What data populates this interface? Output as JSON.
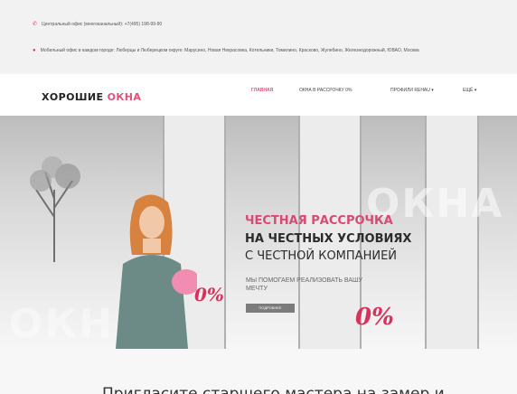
{
  "topbar": {
    "phone_text": "Центральный офис (многоканальный): +7(495) 198-99-90",
    "address_text": "Мобильный офис в каждом городе: Люберцы и Люберецком округе: Марусино, Новая Некрасовка, Котельники, Томилино, Красково, Жулебино, Железнодорожный, ЮВАО, Москва"
  },
  "header": {
    "logo_main": "ХОРОШИЕ ",
    "logo_accent": "ОКНА",
    "nav": {
      "home": "ГЛАВНАЯ",
      "installment": "ОКНА В РАССРОЧКУ 0%",
      "profiles": "ПРОФИЛИ REHAU ▾",
      "more": "ЕЩЁ ▾"
    }
  },
  "hero": {
    "headline_1": "ЧЕСТНАЯ РАССРОЧКА",
    "headline_2": "НА ЧЕСТНЫХ УСЛОВИЯХ",
    "headline_3": "С ЧЕСТНОЙ КОМПАНИЕЙ",
    "subtext": "МЫ ПОМОГАЕМ РЕАЛИЗОВАТЬ ВАШУ МЕЧТУ",
    "button_label": "ПОДРОБНЕЕ",
    "watermark_top": "ОКНА",
    "watermark_bottom": "ОКНА",
    "discount_big": "0%",
    "discount_small": "0%"
  },
  "main": {
    "cta_title": "Пригласите старшего мастера на замер и"
  },
  "colors": {
    "accent": "#e0527a",
    "discount_red": "#d8325c"
  },
  "icons": {
    "phone": "phone-icon",
    "location": "location-pin-icon"
  }
}
